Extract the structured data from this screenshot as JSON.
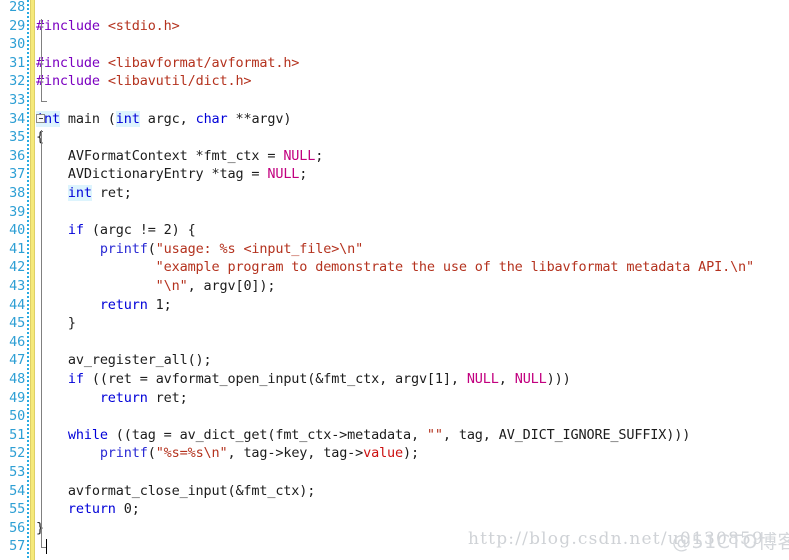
{
  "editor": {
    "name": "source-code-editor",
    "language": "C",
    "first_visible_line": 28,
    "last_visible_line": 57,
    "caret_line": 57,
    "colors": {
      "background": "#ffffff",
      "line_number": "#2e9fd4",
      "change_bar": "#f5e97a",
      "keyword": "#0000d8",
      "keyword_highlight_bg": "#ddf4fd",
      "preprocessor": "#7b00c0",
      "string": "#b4321e",
      "macro_constant": "#c2007f",
      "function": "#2a2ad4",
      "member": "#cc1111",
      "plain": "#1c1c1c",
      "indent_guide": "#808080"
    }
  },
  "gutter": {
    "line_numbers": [
      28,
      29,
      30,
      31,
      32,
      33,
      34,
      35,
      36,
      37,
      38,
      39,
      40,
      41,
      42,
      43,
      44,
      45,
      46,
      47,
      48,
      49,
      50,
      51,
      52,
      53,
      54,
      55,
      56,
      57
    ],
    "outline_box_line": 34,
    "outline_box_state": "expanded",
    "outline_box_glyph": "⊟"
  },
  "lines": [
    {
      "n": 28,
      "tokens": []
    },
    {
      "n": 29,
      "tokens": [
        {
          "t": "#include ",
          "c": "pre"
        },
        {
          "t": "<stdio.h>",
          "c": "str"
        }
      ]
    },
    {
      "n": 30,
      "tokens": []
    },
    {
      "n": 31,
      "tokens": [
        {
          "t": "#include ",
          "c": "pre"
        },
        {
          "t": "<libavformat/avformat.h>",
          "c": "str"
        }
      ]
    },
    {
      "n": 32,
      "tokens": [
        {
          "t": "#include ",
          "c": "pre"
        },
        {
          "t": "<libavutil/dict.h>",
          "c": "str"
        }
      ]
    },
    {
      "n": 33,
      "tokens": []
    },
    {
      "n": 34,
      "tokens": [
        {
          "t": "int",
          "c": "kwhl"
        },
        {
          "t": " main (",
          "c": "pl"
        },
        {
          "t": "int",
          "c": "kwhl"
        },
        {
          "t": " argc, ",
          "c": "pl"
        },
        {
          "t": "char",
          "c": "kw"
        },
        {
          "t": " **argv)",
          "c": "pl"
        }
      ]
    },
    {
      "n": 35,
      "tokens": [
        {
          "t": "{",
          "c": "pl"
        }
      ]
    },
    {
      "n": 36,
      "tokens": [
        {
          "t": "    AVFormatContext *fmt_ctx = ",
          "c": "pl"
        },
        {
          "t": "NULL",
          "c": "mac"
        },
        {
          "t": ";",
          "c": "pl"
        }
      ]
    },
    {
      "n": 37,
      "tokens": [
        {
          "t": "    AVDictionaryEntry *tag = ",
          "c": "pl"
        },
        {
          "t": "NULL",
          "c": "mac"
        },
        {
          "t": ";",
          "c": "pl"
        }
      ]
    },
    {
      "n": 38,
      "tokens": [
        {
          "t": "    ",
          "c": "pl"
        },
        {
          "t": "int",
          "c": "kwhl"
        },
        {
          "t": " ret;",
          "c": "pl"
        }
      ]
    },
    {
      "n": 39,
      "tokens": []
    },
    {
      "n": 40,
      "tokens": [
        {
          "t": "    ",
          "c": "pl"
        },
        {
          "t": "if",
          "c": "kw"
        },
        {
          "t": " (argc != 2) {",
          "c": "pl"
        }
      ]
    },
    {
      "n": 41,
      "tokens": [
        {
          "t": "        ",
          "c": "pl"
        },
        {
          "t": "printf",
          "c": "fn"
        },
        {
          "t": "(",
          "c": "pl"
        },
        {
          "t": "\"usage: %s <input_file>\\n\"",
          "c": "str"
        }
      ]
    },
    {
      "n": 42,
      "tokens": [
        {
          "t": "               ",
          "c": "pl"
        },
        {
          "t": "\"example program to demonstrate the use of the libavformat metadata API.\\n\"",
          "c": "str"
        }
      ]
    },
    {
      "n": 43,
      "tokens": [
        {
          "t": "               ",
          "c": "pl"
        },
        {
          "t": "\"\\n\"",
          "c": "str"
        },
        {
          "t": ", argv[0]);",
          "c": "pl"
        }
      ]
    },
    {
      "n": 44,
      "tokens": [
        {
          "t": "        ",
          "c": "pl"
        },
        {
          "t": "return",
          "c": "kw"
        },
        {
          "t": " 1;",
          "c": "pl"
        }
      ]
    },
    {
      "n": 45,
      "tokens": [
        {
          "t": "    }",
          "c": "pl"
        }
      ]
    },
    {
      "n": 46,
      "tokens": []
    },
    {
      "n": 47,
      "tokens": [
        {
          "t": "    av_register_all();",
          "c": "pl"
        }
      ]
    },
    {
      "n": 48,
      "tokens": [
        {
          "t": "    ",
          "c": "pl"
        },
        {
          "t": "if",
          "c": "kw"
        },
        {
          "t": " ((ret = avformat_open_input(&fmt_ctx, argv[1], ",
          "c": "pl"
        },
        {
          "t": "NULL",
          "c": "mac"
        },
        {
          "t": ", ",
          "c": "pl"
        },
        {
          "t": "NULL",
          "c": "mac"
        },
        {
          "t": ")))",
          "c": "pl"
        }
      ]
    },
    {
      "n": 49,
      "tokens": [
        {
          "t": "        ",
          "c": "pl"
        },
        {
          "t": "return",
          "c": "kw"
        },
        {
          "t": " ret;",
          "c": "pl"
        }
      ]
    },
    {
      "n": 50,
      "tokens": []
    },
    {
      "n": 51,
      "tokens": [
        {
          "t": "    ",
          "c": "pl"
        },
        {
          "t": "while",
          "c": "kw"
        },
        {
          "t": " ((tag = av_dict_get(fmt_ctx->metadata, ",
          "c": "pl"
        },
        {
          "t": "\"\"",
          "c": "str"
        },
        {
          "t": ", tag, AV_DICT_IGNORE_SUFFIX)))",
          "c": "pl"
        }
      ]
    },
    {
      "n": 52,
      "tokens": [
        {
          "t": "        ",
          "c": "pl"
        },
        {
          "t": "printf",
          "c": "fn"
        },
        {
          "t": "(",
          "c": "pl"
        },
        {
          "t": "\"%s=%s\\n\"",
          "c": "str"
        },
        {
          "t": ", tag->key, tag->",
          "c": "pl"
        },
        {
          "t": "value",
          "c": "mem"
        },
        {
          "t": ");",
          "c": "pl"
        }
      ]
    },
    {
      "n": 53,
      "tokens": []
    },
    {
      "n": 54,
      "tokens": [
        {
          "t": "    avformat_close_input(&fmt_ctx);",
          "c": "pl"
        }
      ]
    },
    {
      "n": 55,
      "tokens": [
        {
          "t": "    ",
          "c": "pl"
        },
        {
          "t": "return",
          "c": "kw"
        },
        {
          "t": " 0;",
          "c": "pl"
        }
      ]
    },
    {
      "n": 56,
      "tokens": [
        {
          "t": "}",
          "c": "pl"
        }
      ]
    },
    {
      "n": 57,
      "tokens": []
    }
  ],
  "watermarks": {
    "url": "http://blog.csdn.net/u0130859",
    "brand": "@51CTO博客"
  }
}
